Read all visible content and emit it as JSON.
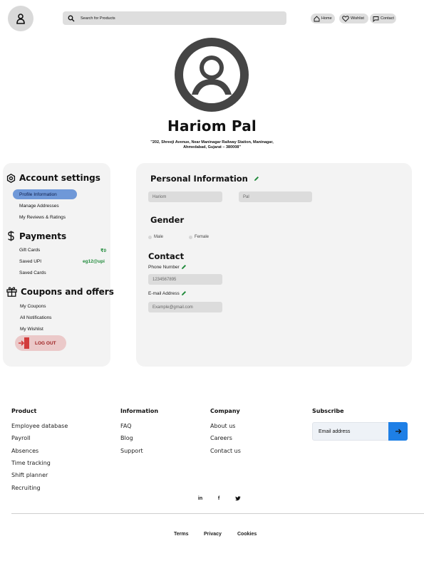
{
  "header": {
    "search_placeholder": "Search for Products",
    "nav": {
      "home": "Home",
      "wishlist": "Wishlist",
      "contact": "Contact"
    }
  },
  "profile": {
    "name": "Hariom Pal",
    "address_line1": "\"202, Shreeji Avenue, Near Maninagar Railway Station, Maninagar,",
    "address_line2": "Ahmedabad, Gujarat – 380008\""
  },
  "account_settings": {
    "title": "Account settings",
    "items": [
      "Profile Information",
      "Manage Addresses",
      "My Reviews & Ratings"
    ]
  },
  "payments": {
    "title": "Payments",
    "gift_cards_label": "Gift Cards",
    "gift_cards_value": "₹0",
    "saved_upi_label": "Saved UPI",
    "saved_upi_value": "eg12@upi",
    "saved_cards_label": "Saved Cards"
  },
  "coupons": {
    "title": "Coupons and offers",
    "items": [
      "My Coupons",
      "All Notifications",
      "My Wishlist"
    ]
  },
  "logout_label": "LOG OUT",
  "personal_info": {
    "title": "Personal Information",
    "first_name": "Hariom",
    "last_name": "Pal",
    "gender_title": "Gender",
    "gender_options": [
      "Male",
      "Female"
    ],
    "contact_title": "Contact",
    "phone_label": "Phone Number",
    "phone_value": "1234567895",
    "email_label": "E-mail Address",
    "email_placeholder": "Example@gmail.com"
  },
  "footer": {
    "product": {
      "title": "Product",
      "links": [
        "Employee database",
        "Payroll",
        "Absences",
        "Time tracking",
        "Shift planner",
        "Recruiting"
      ]
    },
    "information": {
      "title": "Information",
      "links": [
        "FAQ",
        "Blog",
        "Support"
      ]
    },
    "company": {
      "title": "Company",
      "links": [
        "About us",
        "Careers",
        "Contact us"
      ]
    },
    "subscribe": {
      "title": "Subscribe",
      "email_placeholder": "Email address"
    },
    "social": {
      "linkedin": "in",
      "facebook": "f"
    },
    "bottom_links": [
      "Terms",
      "Privacy",
      "Cookies"
    ]
  },
  "colors": {
    "accent_blue": "#1e7fe6",
    "active_menu": "#6f98d8",
    "green": "#1f8a3a",
    "logout_bg": "#ebc9c9",
    "logout_text": "#9b1c1c",
    "card_bg": "#f3f3f3"
  },
  "icons": [
    "user-icon",
    "search-icon",
    "home-icon",
    "heart-icon",
    "chat-icon",
    "settings-icon",
    "dollar-icon",
    "gift-icon",
    "logout-icon",
    "edit-pencil-icon",
    "arrow-right-icon",
    "linkedin-icon",
    "facebook-icon",
    "twitter-icon"
  ]
}
